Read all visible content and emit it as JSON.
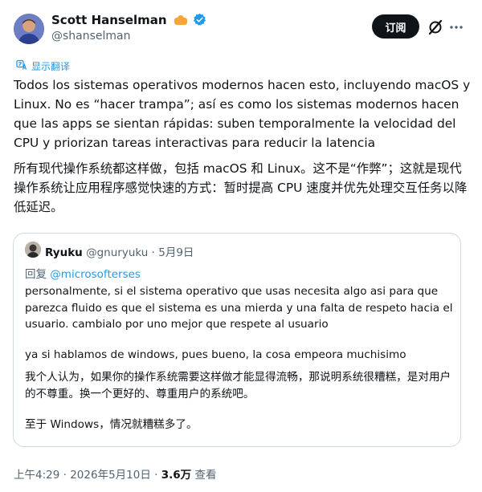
{
  "author": {
    "name": "Scott Hanselman",
    "handle": "@shanselman"
  },
  "actions": {
    "subscribe_label": "订阅"
  },
  "translate_label": "显示翻译",
  "tweet": {
    "text_es": "Todos los sistemas operativos modernos hacen esto, incluyendo macOS y Linux. No es “hacer trampa”; así es como los sistemas modernos hacen que las apps se sientan rápidas: suben temporalmente la velocidad del CPU y priorizan tareas interactivas para reducir la latencia",
    "text_zh": "所有现代操作系统都这样做，包括 macOS 和 Linux。这不是“作弊”；这就是现代操作系统让应用程序感觉快速的方式：暂时提高 CPU 速度并优先处理交互任务以降低延迟。"
  },
  "quote": {
    "name": "Ryuku",
    "handle": "@gnuryuku",
    "separator": "·",
    "date": "5月9日",
    "reply_prefix": "回复",
    "reply_to": "@microsofterses",
    "p1_es": "personalmente, si el sistema operativo que usas necesita algo asi para que parezca fluido es que el sistema es una mierda y una falta de respeto hacia el usuario. cambialo por uno mejor que respete al usuario",
    "p2_es": "ya si hablamos de windows, pues bueno, la cosa empeora muchisimo",
    "p1_zh": "我个人认为，如果你的操作系统需要这样做才能显得流畅，那说明系统很糟糕，是对用户的不尊重。换一个更好的、尊重用户的系统吧。",
    "p2_zh": "至于 Windows，情况就糟糕多了。"
  },
  "footer": {
    "time": "上午4:29",
    "separator": "·",
    "date": "2026年5月10日",
    "views_count": "3.6万",
    "views_label": "查看"
  },
  "colors": {
    "accent": "#1d9bf0",
    "text": "#0f1419",
    "muted": "#536471",
    "border": "#cfd9de",
    "button_bg": "#0f1419"
  },
  "icons": [
    "avatar",
    "verified-badge-icon",
    "org-badge-icon",
    "grok-icon",
    "more-icon",
    "translate-icon"
  ]
}
